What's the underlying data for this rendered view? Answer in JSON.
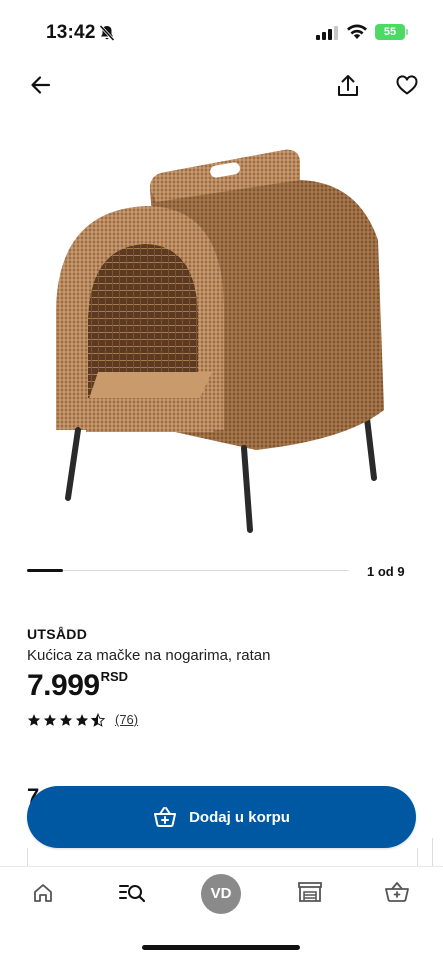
{
  "status_bar": {
    "time": "13:42",
    "battery": "55"
  },
  "header": {
    "back_icon": "arrow-left-icon",
    "share_icon": "share-icon",
    "favorite_icon": "heart-icon"
  },
  "gallery": {
    "pager_text": "1 od 9",
    "current": 1,
    "total": 9
  },
  "product": {
    "brand": "UTSÅDD",
    "description": "Kućica za mačke na nogarima, ratan",
    "price": "7.999",
    "currency": "RSD",
    "rating": 4.5,
    "reviews": "(76)"
  },
  "partial_text": "7",
  "cart_button": {
    "label": "Dodaj u korpu",
    "icon": "basket-plus-icon",
    "color": "#0058a3"
  },
  "tabbar": {
    "home_icon": "home-icon",
    "search_icon": "search-list-icon",
    "avatar_initials": "VD",
    "store_icon": "store-icon",
    "basket_icon": "basket-icon"
  }
}
